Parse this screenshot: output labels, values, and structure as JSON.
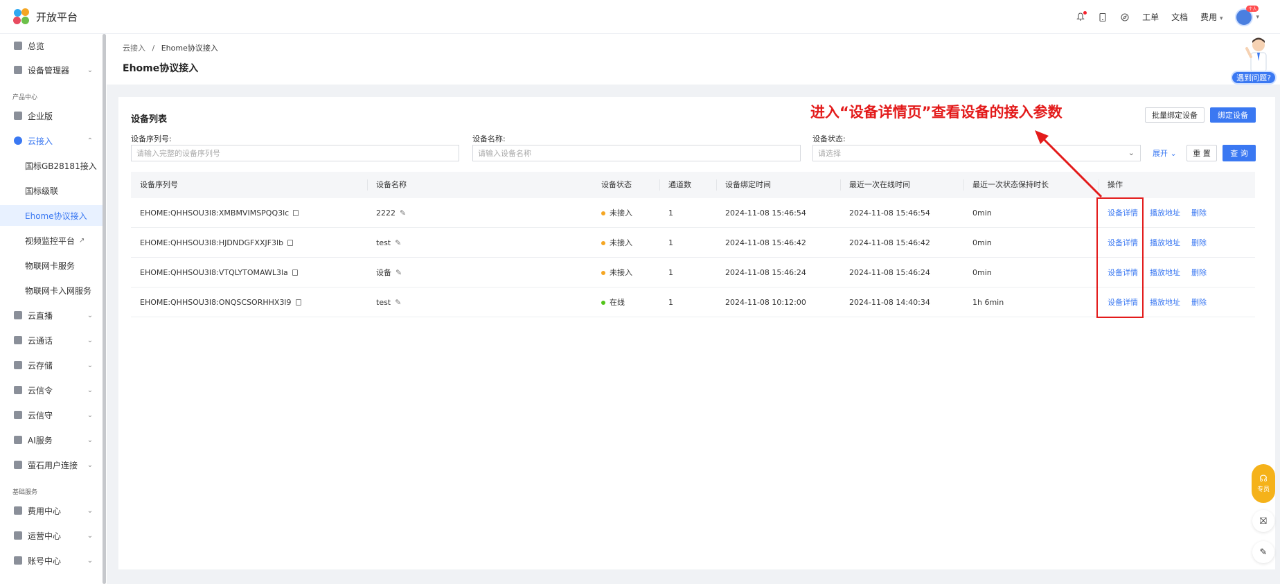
{
  "app": {
    "title": "开放平台"
  },
  "topbar": {
    "links": [
      "工单",
      "文档",
      "费用"
    ],
    "avatar_badge": "个人"
  },
  "sidebar": {
    "items": [
      {
        "label": "总览",
        "chevron": ""
      },
      {
        "label": "设备管理器",
        "chevron": "⌄"
      }
    ],
    "group1": "产品中心",
    "items2": [
      {
        "label": "企业版",
        "chevron": ""
      },
      {
        "label": "云接入",
        "chevron": "⌃"
      }
    ],
    "subs": [
      "国标GB28181接入",
      "国标级联",
      "Ehome协议接入",
      "视频监控平台",
      "物联网卡服务",
      "物联网卡入网服务"
    ],
    "items3": [
      {
        "label": "云直播",
        "chevron": "⌄"
      },
      {
        "label": "云通话",
        "chevron": "⌄"
      },
      {
        "label": "云存储",
        "chevron": "⌄"
      },
      {
        "label": "云信令",
        "chevron": "⌄"
      },
      {
        "label": "云信守",
        "chevron": "⌄"
      },
      {
        "label": "AI服务",
        "chevron": "⌄"
      },
      {
        "label": "萤石用户连接",
        "chevron": "⌄"
      }
    ],
    "group2": "基础服务",
    "items4": [
      {
        "label": "费用中心",
        "chevron": "⌄"
      },
      {
        "label": "运营中心",
        "chevron": "⌄"
      },
      {
        "label": "账号中心",
        "chevron": "⌄"
      }
    ]
  },
  "breadcrumb": {
    "root": "云接入",
    "sep": "/",
    "current": "Ehome协议接入"
  },
  "page_title": "Ehome协议接入",
  "card": {
    "title": "设备列表",
    "batch_bind": "批量绑定设备",
    "bind": "绑定设备"
  },
  "filters": {
    "serial_label": "设备序列号:",
    "serial_placeholder": "请输入完整的设备序列号",
    "name_label": "设备名称:",
    "name_placeholder": "请输入设备名称",
    "status_label": "设备状态:",
    "status_placeholder": "请选择",
    "expand": "展开",
    "reset": "重 置",
    "search": "查 询"
  },
  "table": {
    "headers": [
      "设备序列号",
      "设备名称",
      "设备状态",
      "通道数",
      "设备绑定时间",
      "最近一次在线时间",
      "最近一次状态保持时长",
      "操作"
    ],
    "rows": [
      {
        "serial": "EHOME:QHHSOU3I8:XMBMVIMSPQQ3lc",
        "name": "2222",
        "status": "未接入",
        "channels": "1",
        "bind_time": "2024-11-08 15:46:54",
        "last_online": "2024-11-08 15:46:54",
        "duration": "0min"
      },
      {
        "serial": "EHOME:QHHSOU3I8:HJDNDGFXXJF3lb",
        "name": "test",
        "status": "未接入",
        "channels": "1",
        "bind_time": "2024-11-08 15:46:42",
        "last_online": "2024-11-08 15:46:42",
        "duration": "0min"
      },
      {
        "serial": "EHOME:QHHSOU3I8:VTQLYTOMAWL3la",
        "name": "设备",
        "status": "未接入",
        "channels": "1",
        "bind_time": "2024-11-08 15:46:24",
        "last_online": "2024-11-08 15:46:24",
        "duration": "0min"
      },
      {
        "serial": "EHOME:QHHSOU3I8:ONQSCSORHHX3l9",
        "name": "test",
        "status": "在线",
        "channels": "1",
        "bind_time": "2024-11-08 10:12:00",
        "last_online": "2024-11-08 14:40:34",
        "duration": "1h 6min"
      }
    ],
    "actions": {
      "detail": "设备详情",
      "playback": "播放地址",
      "delete": "删除"
    }
  },
  "annotation": "进入“设备详情页”查看设备的接入参数",
  "help": {
    "pill": "遇到问题?"
  },
  "float": {
    "kefu": "专员"
  },
  "colors": {
    "primary": "#3a78f2",
    "status_offline": "#f5a623",
    "status_online": "#52c41a",
    "annotation_red": "#e31b1b"
  }
}
